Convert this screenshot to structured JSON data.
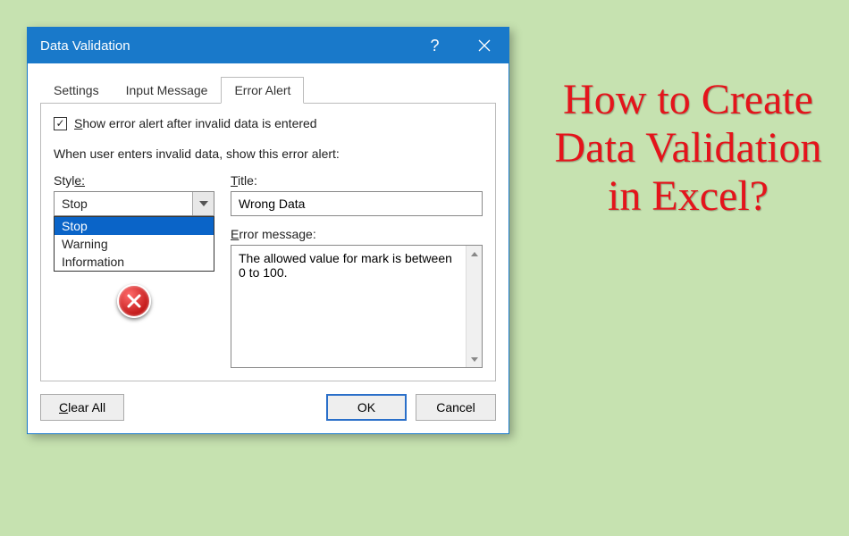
{
  "dialog": {
    "title": "Data Validation",
    "tabs": {
      "settings": "Settings",
      "input_message": "Input Message",
      "error_alert": "Error Alert"
    },
    "checkbox_label_pre": "S",
    "checkbox_label_post": "how error alert after invalid data is entered",
    "instruction": "When user enters invalid data, show this error alert:",
    "style_label_pre": "Styl",
    "style_label_post": "e:",
    "style_value": "Stop",
    "style_options": {
      "stop": "Stop",
      "warning": "Warning",
      "information": "Information"
    },
    "title_field_label_pre": "T",
    "title_field_label_post": "itle:",
    "title_field_value": "Wrong Data",
    "error_msg_label_pre": "E",
    "error_msg_label_post": "rror message:",
    "error_msg_value": "The allowed value for mark is between 0 to 100.",
    "buttons": {
      "clear_all_pre": "C",
      "clear_all_post": "lear All",
      "ok": "OK",
      "cancel": "Cancel"
    }
  },
  "headline": "How to Create Data Validation in Excel?"
}
